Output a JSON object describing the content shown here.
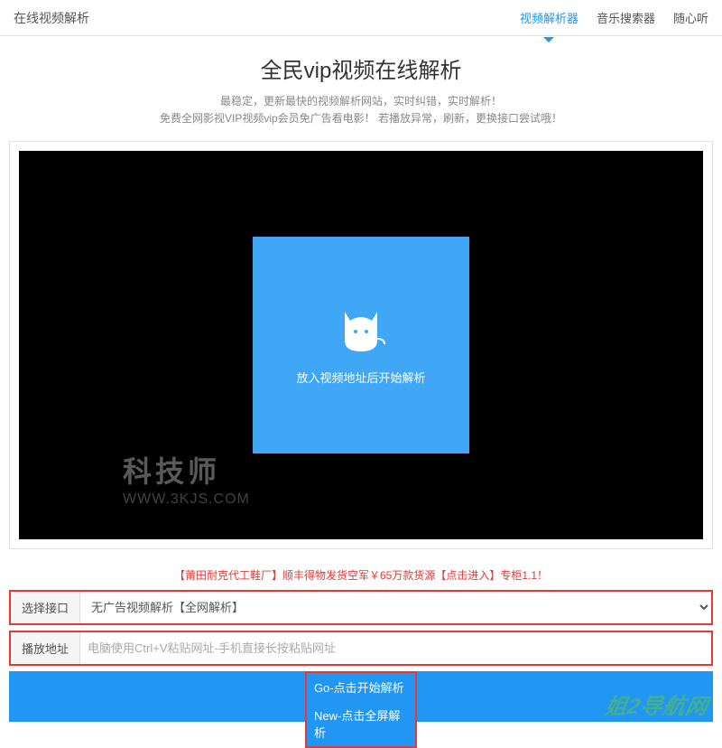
{
  "header": {
    "title": "在线视频解析",
    "nav": [
      {
        "label": "视频解析器",
        "active": true
      },
      {
        "label": "音乐搜索器",
        "active": false
      },
      {
        "label": "随心听",
        "active": false
      }
    ]
  },
  "main": {
    "title": "全民vip视频在线解析",
    "subtitle_line1": "最稳定，更新最快的视频解析网站，实时纠错，实时解析！",
    "subtitle_line2": "免费全网影视VIP视频vip会员免广告看电影！ 若播放异常，刷新，更换接口尝试哦！"
  },
  "video": {
    "placeholder_text": "放入视频地址后开始解析"
  },
  "watermark": {
    "main": "科技师",
    "sub": "WWW.3KJS.COM",
    "footer": "姐2导航网"
  },
  "ad": {
    "text": "【莆田耐克代工鞋厂】顺丰得物发货空军￥65万款货源【点击进入】专柜1.1！"
  },
  "form": {
    "interface_label": "选择接口",
    "interface_value": "无广告视频解析【全网解析】",
    "address_label": "播放地址",
    "address_placeholder": "电脑使用Ctrl+V粘贴网址-手机直接长按粘贴网址"
  },
  "buttons": {
    "go": "Go-点击开始解析",
    "new": "New-点击全屏解析"
  }
}
